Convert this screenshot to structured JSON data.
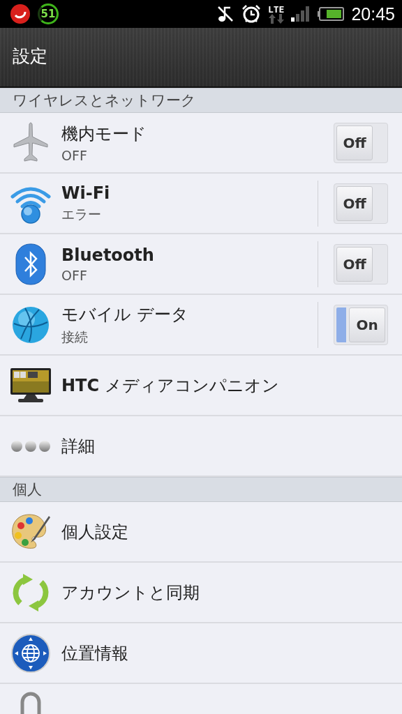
{
  "status_bar": {
    "notification_count": "51",
    "network": "LTE",
    "time": "20:45"
  },
  "title": "設定",
  "sections": [
    {
      "header": "ワイヤレスとネットワーク",
      "items": [
        {
          "kind": "toggle",
          "title": "機内モード",
          "bold": false,
          "subtitle": "OFF",
          "toggle_label": "Off",
          "on": false
        },
        {
          "kind": "split-toggle",
          "title": "Wi-Fi",
          "bold": true,
          "subtitle": "エラー",
          "toggle_label": "Off",
          "on": false
        },
        {
          "kind": "split-toggle",
          "title": "Bluetooth",
          "bold": true,
          "subtitle": "OFF",
          "toggle_label": "Off",
          "on": false
        },
        {
          "kind": "split-toggle",
          "title": "モバイル データ",
          "bold": false,
          "subtitle": "接続",
          "toggle_label": "On",
          "on": true
        },
        {
          "kind": "plain",
          "title": "**HTC** メディアコンパニオン",
          "bold": false
        },
        {
          "kind": "plain",
          "title": "詳細",
          "bold": false
        }
      ]
    },
    {
      "header": "個人",
      "items": [
        {
          "kind": "plain",
          "title": "個人設定",
          "bold": false
        },
        {
          "kind": "plain",
          "title": "アカウントと同期",
          "bold": false
        },
        {
          "kind": "plain",
          "title": "位置情報",
          "bold": false
        },
        {
          "kind": "plain"
        }
      ]
    }
  ]
}
